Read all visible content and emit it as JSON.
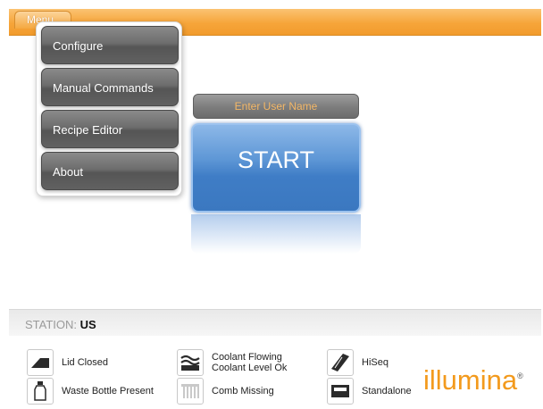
{
  "menu": {
    "tab_label": "Menu",
    "items": [
      "Configure",
      "Manual Commands",
      "Recipe Editor",
      "About"
    ]
  },
  "main": {
    "username_placeholder": "Enter User Name",
    "start_label": "START"
  },
  "station": {
    "prefix": "STATION:",
    "name": "US"
  },
  "status": {
    "lid": "Lid Closed",
    "waste": "Waste Bottle Present",
    "coolant_line1": "Coolant Flowing",
    "coolant_line2": "Coolant Level Ok",
    "comb": "Comb Missing",
    "hiseq": "HiSeq",
    "standalone": "Standalone"
  },
  "brand": {
    "name": "illumina",
    "mark": "®"
  },
  "colors": {
    "accent_orange": "#f6a53a",
    "start_blue": "#3f7dc6",
    "menu_gray": "#6d6d6d"
  }
}
